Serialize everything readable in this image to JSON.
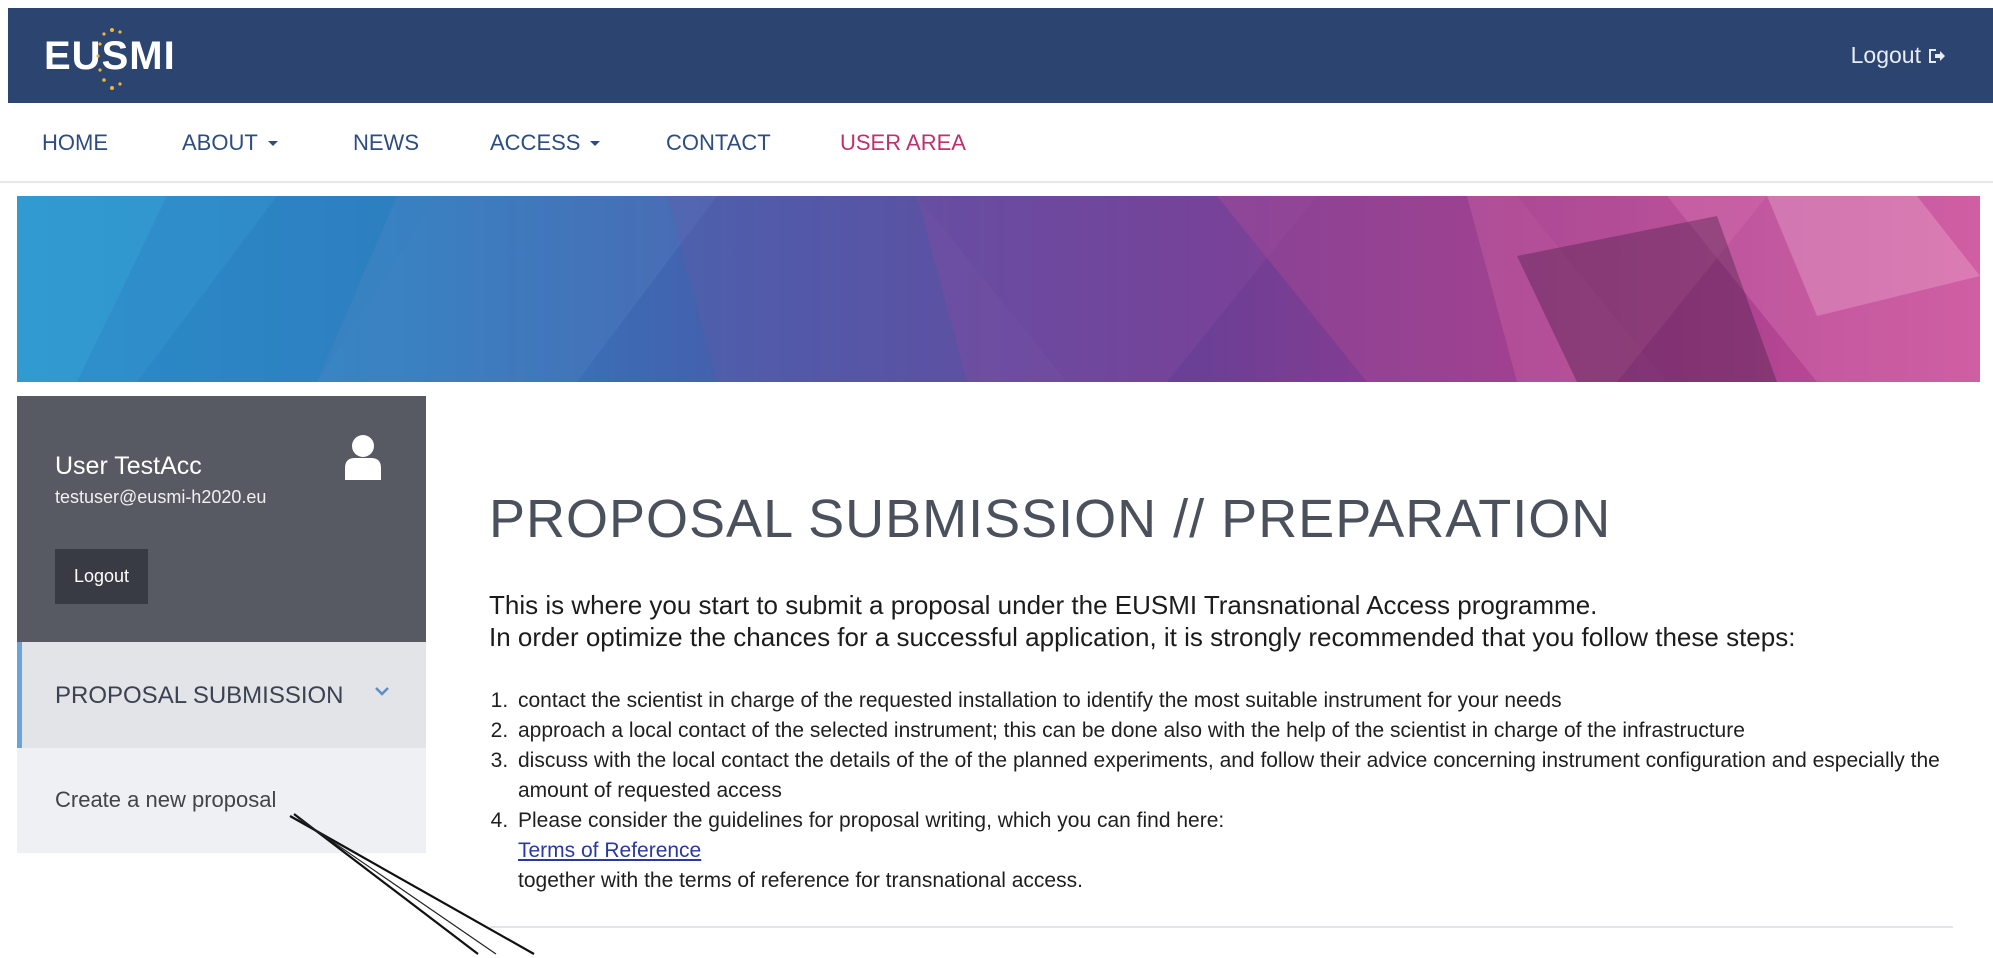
{
  "header": {
    "logo_text": "EUSMI",
    "logout_label": "Logout",
    "logout_icon": "sign-out-icon"
  },
  "nav": {
    "items": [
      {
        "label": "HOME",
        "dropdown": false,
        "active": false
      },
      {
        "label": "ABOUT",
        "dropdown": true,
        "active": false
      },
      {
        "label": "NEWS",
        "dropdown": false,
        "active": false
      },
      {
        "label": "ACCESS",
        "dropdown": true,
        "active": false
      },
      {
        "label": "CONTACT",
        "dropdown": false,
        "active": false
      },
      {
        "label": "USER AREA",
        "dropdown": false,
        "active": true
      }
    ]
  },
  "sidebar": {
    "user_name": "User TestAcc",
    "user_email": "testuser@eusmi-h2020.eu",
    "logout_label": "Logout",
    "avatar_icon": "user-icon",
    "section_label": "PROPOSAL SUBMISSION",
    "section_icon": "chevron-down-icon",
    "section_item": "Create a new proposal"
  },
  "main": {
    "title": "PROPOSAL SUBMISSION // PREPARATION",
    "intro_line1": "This is where you start to submit a proposal under the EUSMI Transnational Access programme.",
    "intro_line2": "In order optimize the chances for a successful application, it is strongly recommended that you follow these steps:",
    "steps": [
      "contact the scientist in charge of the requested installation to identify the most suitable instrument for your needs",
      "approach a local contact of the selected instrument; this can be done also with the help of the scientist in charge of the infrastructure",
      "discuss with the local contact the details of the of the planned experiments, and follow their advice concerning instrument configuration and especially the amount of requested access",
      "Please consider the guidelines for proposal writing, which you can find here:"
    ],
    "terms_link": "Terms of Reference",
    "terms_after": "together with the terms of reference for transnational access."
  },
  "colors": {
    "header_bg": "#2c4470",
    "nav_text": "#2d4d82",
    "nav_active": "#c0306c",
    "sidebar_bg": "#575a63",
    "accent": "#6aa4d8"
  }
}
